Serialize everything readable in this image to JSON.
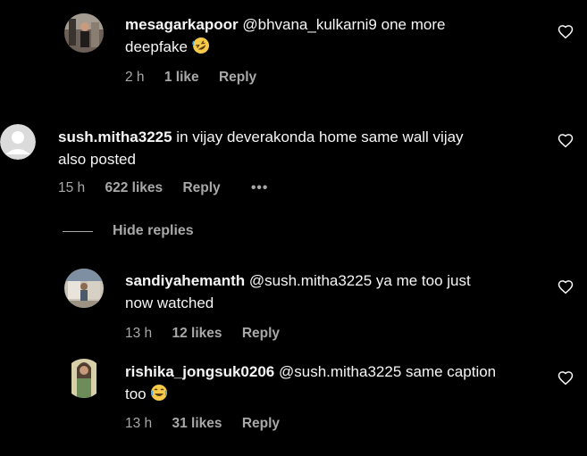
{
  "comments": [
    {
      "username": "mesagarkapoor",
      "mention": "@bhvana_kulkarni9",
      "text_line1": "one more",
      "text_line2": "deepfake",
      "emoji": "rolling-on-floor-laughing-emoji",
      "time": "2 h",
      "likes": "1 like",
      "reply": "Reply",
      "avatar": "photo-avatar"
    },
    {
      "username": "sush.mitha3225",
      "text_line1": "in vijay deverakonda home same wall vijay",
      "text_line2": "also posted",
      "time": "15 h",
      "likes": "622 likes",
      "reply": "Reply",
      "more": "•••",
      "avatar": "default-avatar"
    }
  ],
  "hide_replies": {
    "label": "Hide replies"
  },
  "replies": [
    {
      "username": "sandiyahemanth",
      "mention": "@sush.mitha3225",
      "text_line1": "ya me too just",
      "text_line2": "now watched",
      "time": "13 h",
      "likes": "12 likes",
      "reply": "Reply",
      "avatar": "photo-avatar"
    },
    {
      "username": "rishika_jongsuk0206",
      "mention": "@sush.mitha3225",
      "text_line1": "same caption",
      "text_line2": "too",
      "emoji": "tears-of-joy-emoji",
      "time": "13 h",
      "likes": "31 likes",
      "reply": "Reply",
      "avatar": "photo-avatar"
    }
  ],
  "colors": {
    "background": "#000000",
    "text": "#f5f5f5",
    "secondary_text": "#a8a8a8",
    "emoji_yellow": "#f7c948"
  },
  "icons": {
    "like": "heart-outline-icon",
    "more": "more-dots-icon"
  }
}
